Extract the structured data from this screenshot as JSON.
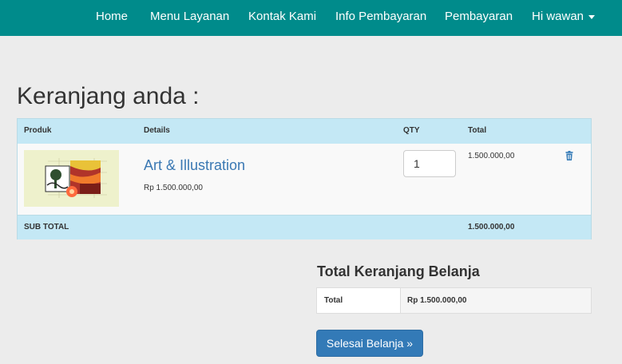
{
  "nav": {
    "home": "Home",
    "menu_layanan": "Menu Layanan",
    "kontak_kami": "Kontak Kami",
    "info_pembayaran": "Info Pembayaran",
    "pembayaran": "Pembayaran",
    "user_menu": "Hi wawan"
  },
  "page": {
    "title": "Keranjang anda :"
  },
  "cart": {
    "headers": {
      "produk": "Produk",
      "details": "Details",
      "qty": "QTY",
      "total": "Total"
    },
    "items": [
      {
        "name": "Art & Illustration",
        "price": "Rp 1.500.000,00",
        "qty": "1",
        "total": "1.500.000,00"
      }
    ],
    "footer": {
      "label": "SUB TOTAL",
      "value": "1.500.000,00"
    }
  },
  "summary": {
    "title": "Total Keranjang Belanja",
    "label": "Total",
    "value": "Rp 1.500.000,00"
  },
  "actions": {
    "finish": "Selesai Belanja »"
  },
  "colors": {
    "navbar": "#008b8b",
    "accent": "#337ab7",
    "table_header": "#c4e8f5"
  },
  "icons": {
    "delete": "trash-icon",
    "dropdown": "caret-down-icon"
  }
}
